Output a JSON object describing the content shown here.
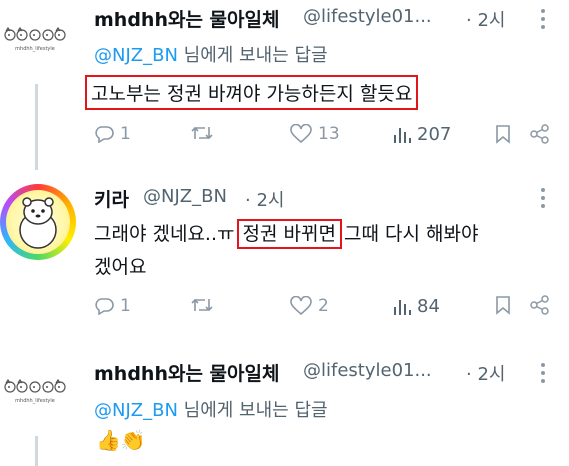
{
  "tweets": [
    {
      "name": "mhdhh와는 물아일체",
      "handle": "@lifestyle01...",
      "time": "· 2시",
      "reply_prefix_mention": "@NJZ_BN",
      "reply_suffix": " 님에게 보내는 답글",
      "text": "고노부는 정권 바껴야 가능하든지 할듯요",
      "reply_count": "1",
      "retweet_count": "",
      "like_count": "13",
      "view_count": "207",
      "avatar_caption": "mhdhh_lifestyle"
    },
    {
      "name": "키라",
      "handle": "@NJZ_BN",
      "time": "· 2시",
      "text_before": "그래야 겠네요..ㅠ ",
      "text_highlight": "정권 바뀌면",
      "text_after": " 그때 다시 해봐야",
      "text_line2": "겠어요",
      "reply_count": "1",
      "retweet_count": "",
      "like_count": "2",
      "view_count": "84"
    },
    {
      "name": "mhdhh와는 물아일체",
      "handle": "@lifestyle01...",
      "time": "· 2시",
      "reply_prefix_mention": "@NJZ_BN",
      "reply_suffix": " 님에게 보내는 답글",
      "text": "👍👏",
      "avatar_caption": "mhdhh_lifestyle"
    }
  ],
  "colors": {
    "accent": "#1d9bf0",
    "highlight_border": "#e0161b",
    "secondary_text": "#536471",
    "icon": "#8b98a5"
  },
  "icons": [
    "reply-icon",
    "retweet-icon",
    "like-icon",
    "views-icon",
    "bookmark-icon",
    "share-icon",
    "more-icon"
  ]
}
